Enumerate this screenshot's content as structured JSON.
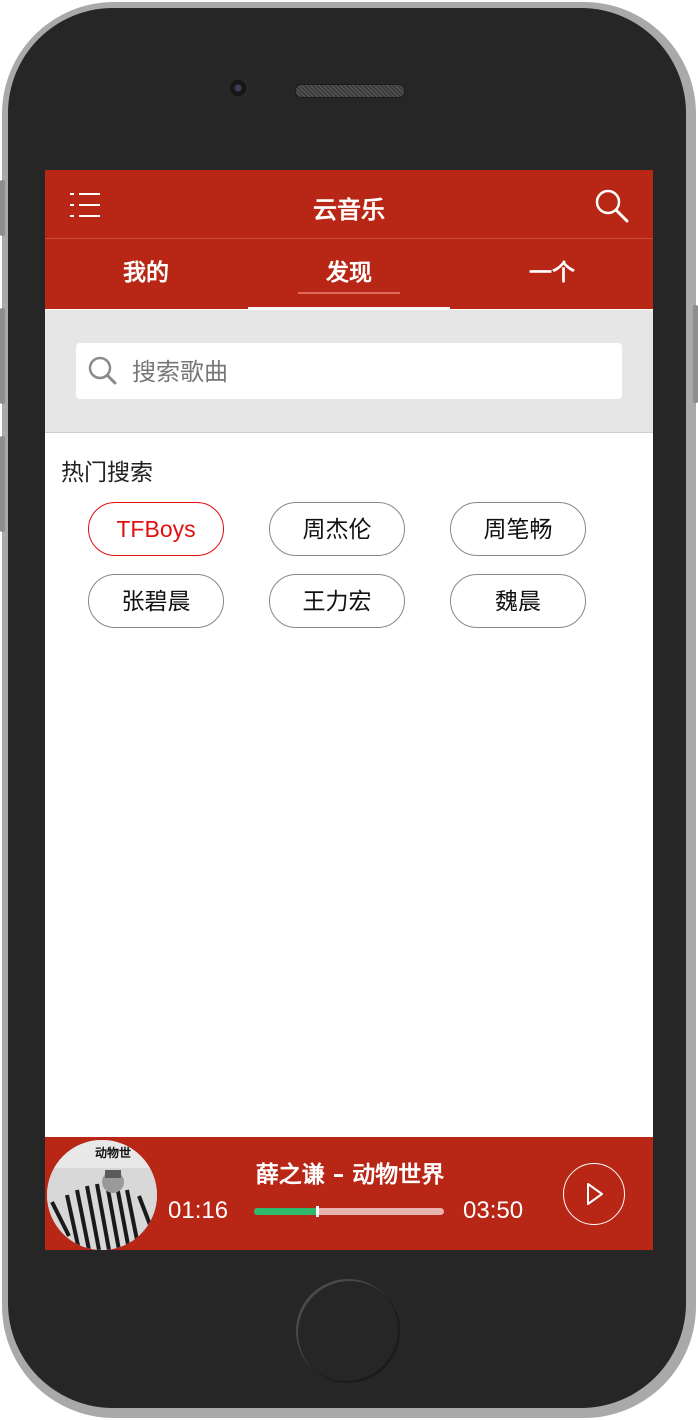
{
  "header": {
    "title": "云音乐"
  },
  "tabs": [
    {
      "label": "我的"
    },
    {
      "label": "发现"
    },
    {
      "label": "一个"
    }
  ],
  "search": {
    "placeholder": "搜索歌曲"
  },
  "hot": {
    "title": "热门搜索",
    "chips": [
      "TFBoys",
      "周杰伦",
      "周笔畅",
      "张碧晨",
      "王力宏",
      "魏晨"
    ],
    "active_index": 0
  },
  "player": {
    "album_text": "动物世",
    "song": "薛之谦 – 动物世界",
    "current_time": "01:16",
    "total_time": "03:50",
    "progress": 0.33
  },
  "colors": {
    "brand_red": "#b82616",
    "chip_active": "#e01010",
    "progress_green": "#2fb86b"
  }
}
